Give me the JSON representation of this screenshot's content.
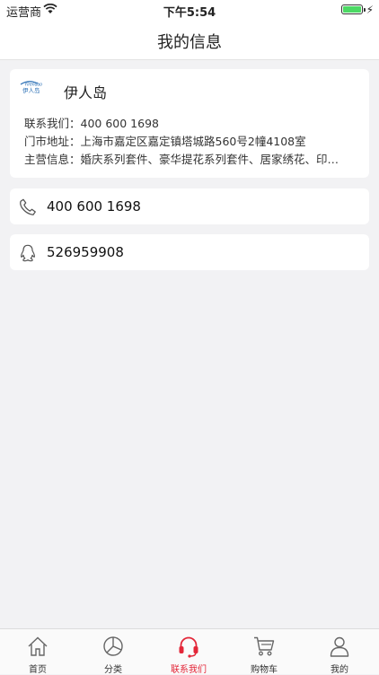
{
  "status_bar": {
    "carrier": "运营商",
    "time": "下午5:54"
  },
  "nav": {
    "title": "我的信息"
  },
  "shop": {
    "logo_text": "伊人岛",
    "name": "伊人岛",
    "contact_label": "联系我们：",
    "contact_value": "400 600 1698",
    "address_label": "门市地址：",
    "address_value": "上海市嘉定区嘉定镇塔城路560号2幢4108室",
    "business_label": "主营信息：",
    "business_value": "婚庆系列套件、豪华提花系列套件、居家绣花、印…"
  },
  "phone": {
    "icon": "phone-icon",
    "value": "400 600 1698"
  },
  "qq": {
    "icon": "qq-icon",
    "value": "526959908"
  },
  "tabs": [
    {
      "label": "首页",
      "icon": "home-icon"
    },
    {
      "label": "分类",
      "icon": "category-icon"
    },
    {
      "label": "联系我们",
      "icon": "headset-icon",
      "active": true
    },
    {
      "label": "购物车",
      "icon": "cart-icon"
    },
    {
      "label": "我的",
      "icon": "user-icon"
    }
  ],
  "colors": {
    "accent": "#e32638",
    "background": "#f2f2f4",
    "battery": "#4cd964"
  }
}
